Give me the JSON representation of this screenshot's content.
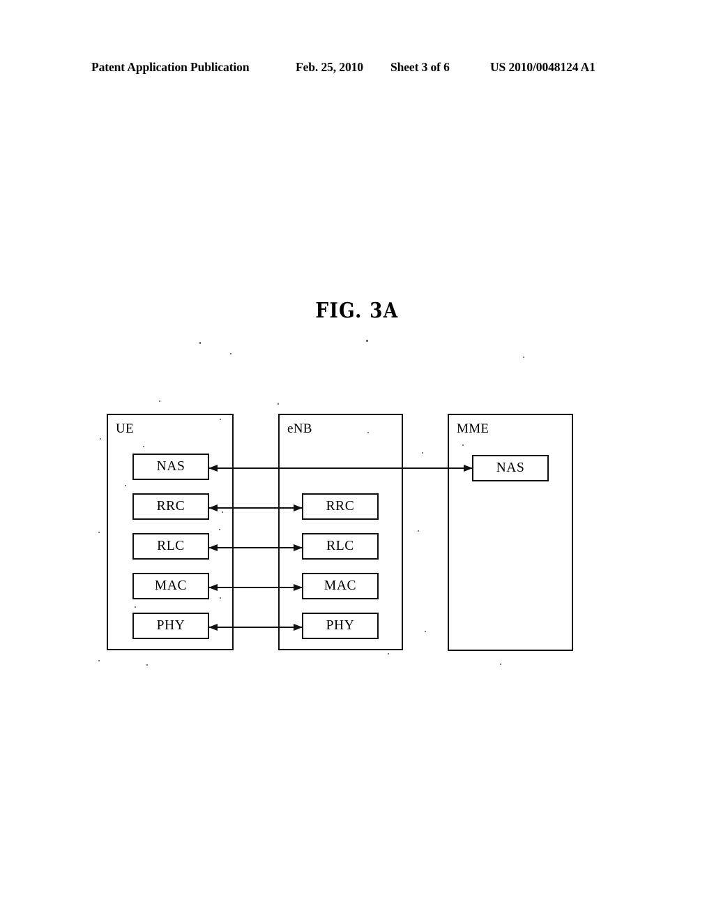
{
  "header": {
    "publication": "Patent Application Publication",
    "date": "Feb. 25, 2010",
    "sheet": "Sheet 3 of 6",
    "document_number": "US 2010/0048124 A1"
  },
  "figure": {
    "title": "FIG. 3A"
  },
  "diagram": {
    "type": "block-diagram",
    "entities": [
      {
        "id": "ue",
        "label": "UE",
        "layers": [
          "NAS",
          "RRC",
          "RLC",
          "MAC",
          "PHY"
        ]
      },
      {
        "id": "enb",
        "label": "eNB",
        "layers": [
          "RRC",
          "RLC",
          "MAC",
          "PHY"
        ]
      },
      {
        "id": "mme",
        "label": "MME",
        "layers": [
          "NAS"
        ]
      }
    ],
    "connections": [
      {
        "layer": "NAS",
        "from": "ue",
        "to": "mme",
        "style": "double-headed"
      },
      {
        "layer": "RRC",
        "from": "ue",
        "to": "enb",
        "style": "double-headed"
      },
      {
        "layer": "RLC",
        "from": "ue",
        "to": "enb",
        "style": "double-headed"
      },
      {
        "layer": "MAC",
        "from": "ue",
        "to": "enb",
        "style": "double-headed"
      },
      {
        "layer": "PHY",
        "from": "ue",
        "to": "enb",
        "style": "double-headed"
      }
    ]
  },
  "colors": {
    "ink": "#111111",
    "paper": "#ffffff"
  }
}
